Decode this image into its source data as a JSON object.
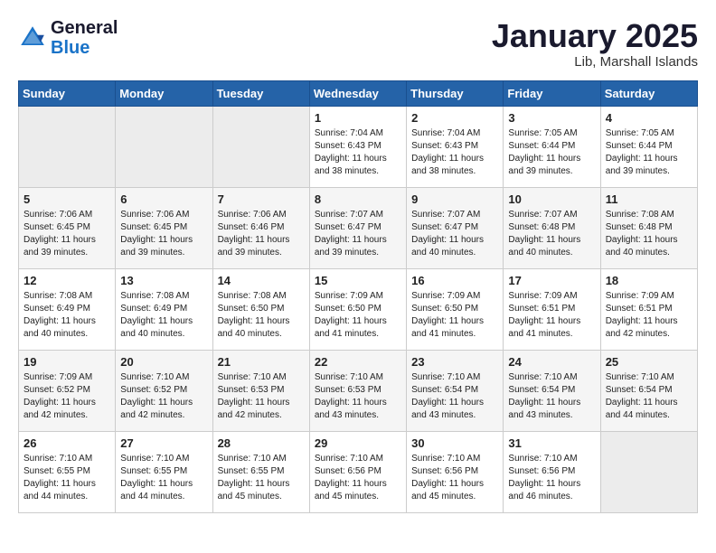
{
  "header": {
    "logo_line1": "General",
    "logo_line2": "Blue",
    "calendar_title": "January 2025",
    "calendar_subtitle": "Lib, Marshall Islands"
  },
  "weekdays": [
    "Sunday",
    "Monday",
    "Tuesday",
    "Wednesday",
    "Thursday",
    "Friday",
    "Saturday"
  ],
  "weeks": [
    [
      {
        "day": "",
        "info": ""
      },
      {
        "day": "",
        "info": ""
      },
      {
        "day": "",
        "info": ""
      },
      {
        "day": "1",
        "info": "Sunrise: 7:04 AM\nSunset: 6:43 PM\nDaylight: 11 hours\nand 38 minutes."
      },
      {
        "day": "2",
        "info": "Sunrise: 7:04 AM\nSunset: 6:43 PM\nDaylight: 11 hours\nand 38 minutes."
      },
      {
        "day": "3",
        "info": "Sunrise: 7:05 AM\nSunset: 6:44 PM\nDaylight: 11 hours\nand 39 minutes."
      },
      {
        "day": "4",
        "info": "Sunrise: 7:05 AM\nSunset: 6:44 PM\nDaylight: 11 hours\nand 39 minutes."
      }
    ],
    [
      {
        "day": "5",
        "info": "Sunrise: 7:06 AM\nSunset: 6:45 PM\nDaylight: 11 hours\nand 39 minutes."
      },
      {
        "day": "6",
        "info": "Sunrise: 7:06 AM\nSunset: 6:45 PM\nDaylight: 11 hours\nand 39 minutes."
      },
      {
        "day": "7",
        "info": "Sunrise: 7:06 AM\nSunset: 6:46 PM\nDaylight: 11 hours\nand 39 minutes."
      },
      {
        "day": "8",
        "info": "Sunrise: 7:07 AM\nSunset: 6:47 PM\nDaylight: 11 hours\nand 39 minutes."
      },
      {
        "day": "9",
        "info": "Sunrise: 7:07 AM\nSunset: 6:47 PM\nDaylight: 11 hours\nand 40 minutes."
      },
      {
        "day": "10",
        "info": "Sunrise: 7:07 AM\nSunset: 6:48 PM\nDaylight: 11 hours\nand 40 minutes."
      },
      {
        "day": "11",
        "info": "Sunrise: 7:08 AM\nSunset: 6:48 PM\nDaylight: 11 hours\nand 40 minutes."
      }
    ],
    [
      {
        "day": "12",
        "info": "Sunrise: 7:08 AM\nSunset: 6:49 PM\nDaylight: 11 hours\nand 40 minutes."
      },
      {
        "day": "13",
        "info": "Sunrise: 7:08 AM\nSunset: 6:49 PM\nDaylight: 11 hours\nand 40 minutes."
      },
      {
        "day": "14",
        "info": "Sunrise: 7:08 AM\nSunset: 6:50 PM\nDaylight: 11 hours\nand 40 minutes."
      },
      {
        "day": "15",
        "info": "Sunrise: 7:09 AM\nSunset: 6:50 PM\nDaylight: 11 hours\nand 41 minutes."
      },
      {
        "day": "16",
        "info": "Sunrise: 7:09 AM\nSunset: 6:50 PM\nDaylight: 11 hours\nand 41 minutes."
      },
      {
        "day": "17",
        "info": "Sunrise: 7:09 AM\nSunset: 6:51 PM\nDaylight: 11 hours\nand 41 minutes."
      },
      {
        "day": "18",
        "info": "Sunrise: 7:09 AM\nSunset: 6:51 PM\nDaylight: 11 hours\nand 42 minutes."
      }
    ],
    [
      {
        "day": "19",
        "info": "Sunrise: 7:09 AM\nSunset: 6:52 PM\nDaylight: 11 hours\nand 42 minutes."
      },
      {
        "day": "20",
        "info": "Sunrise: 7:10 AM\nSunset: 6:52 PM\nDaylight: 11 hours\nand 42 minutes."
      },
      {
        "day": "21",
        "info": "Sunrise: 7:10 AM\nSunset: 6:53 PM\nDaylight: 11 hours\nand 42 minutes."
      },
      {
        "day": "22",
        "info": "Sunrise: 7:10 AM\nSunset: 6:53 PM\nDaylight: 11 hours\nand 43 minutes."
      },
      {
        "day": "23",
        "info": "Sunrise: 7:10 AM\nSunset: 6:54 PM\nDaylight: 11 hours\nand 43 minutes."
      },
      {
        "day": "24",
        "info": "Sunrise: 7:10 AM\nSunset: 6:54 PM\nDaylight: 11 hours\nand 43 minutes."
      },
      {
        "day": "25",
        "info": "Sunrise: 7:10 AM\nSunset: 6:54 PM\nDaylight: 11 hours\nand 44 minutes."
      }
    ],
    [
      {
        "day": "26",
        "info": "Sunrise: 7:10 AM\nSunset: 6:55 PM\nDaylight: 11 hours\nand 44 minutes."
      },
      {
        "day": "27",
        "info": "Sunrise: 7:10 AM\nSunset: 6:55 PM\nDaylight: 11 hours\nand 44 minutes."
      },
      {
        "day": "28",
        "info": "Sunrise: 7:10 AM\nSunset: 6:55 PM\nDaylight: 11 hours\nand 45 minutes."
      },
      {
        "day": "29",
        "info": "Sunrise: 7:10 AM\nSunset: 6:56 PM\nDaylight: 11 hours\nand 45 minutes."
      },
      {
        "day": "30",
        "info": "Sunrise: 7:10 AM\nSunset: 6:56 PM\nDaylight: 11 hours\nand 45 minutes."
      },
      {
        "day": "31",
        "info": "Sunrise: 7:10 AM\nSunset: 6:56 PM\nDaylight: 11 hours\nand 46 minutes."
      },
      {
        "day": "",
        "info": ""
      }
    ]
  ]
}
